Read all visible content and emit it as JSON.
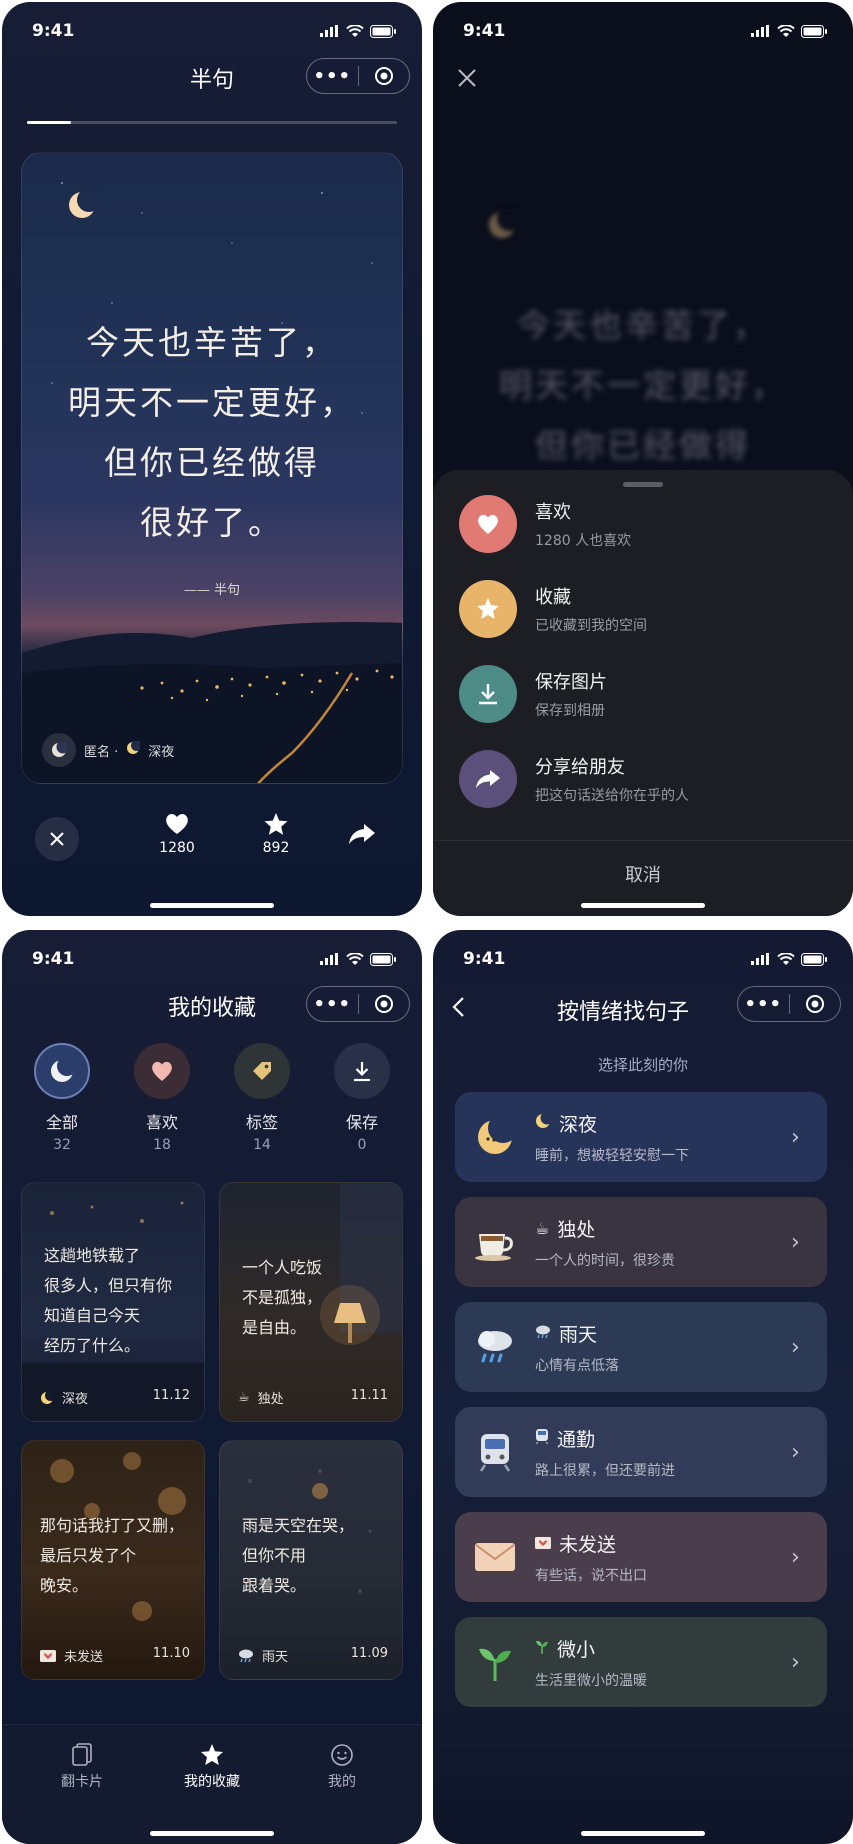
{
  "status_time": "9:41",
  "screen1": {
    "title": "半句",
    "progress": 0.12,
    "quote_lines": [
      "今天也辛苦了，",
      "明天不一定更好，",
      "但你已经做得",
      "很好了。"
    ],
    "author": "—— 半句",
    "footer_user": "匿名 ·",
    "footer_tag": "深夜",
    "likes": "1280",
    "favorites": "892"
  },
  "screen2": {
    "blur_lines": [
      "今天也辛苦了，",
      "明天不一定更好，",
      "但你已经做得"
    ],
    "menu": [
      {
        "title": "喜欢",
        "sub": "1280 人也喜欢",
        "icon": "heart-icon",
        "color": "#e07a73"
      },
      {
        "title": "收藏",
        "sub": "已收藏到我的空间",
        "icon": "star-icon",
        "color": "#e7b46a"
      },
      {
        "title": "保存图片",
        "sub": "保存到相册",
        "icon": "download-icon",
        "color": "#4d8b86"
      },
      {
        "title": "分享给朋友",
        "sub": "把这句话送给你在乎的人",
        "icon": "share-icon",
        "color": "#5b4f7c"
      }
    ],
    "cancel": "取消"
  },
  "screen3": {
    "title": "我的收藏",
    "filters": [
      {
        "label": "全部",
        "count": "32"
      },
      {
        "label": "喜欢",
        "count": "18"
      },
      {
        "label": "标签",
        "count": "14"
      },
      {
        "label": "保存",
        "count": "0"
      }
    ],
    "cards": [
      {
        "text": "这趟地铁载了很多人，但只有你知道自己今天经历了什么。",
        "tag": "深夜",
        "date": "11.12"
      },
      {
        "text": "一个人吃饭不是孤独，是自由。",
        "tag": "独处",
        "date": "11.11"
      },
      {
        "text": "那句话我打了又删，最后只发了个晚安。",
        "tag": "未发送",
        "date": "11.10"
      },
      {
        "text": "雨是天空在哭，但你不用跟着哭。",
        "tag": "雨天",
        "date": "11.09"
      }
    ],
    "card_lines": [
      [
        "这趟地铁载了",
        "很多人，但只有你",
        "知道自己今天",
        "经历了什么。"
      ],
      [
        "一个人吃饭",
        "不是孤独，",
        "是自由。"
      ],
      [
        "那句话我打了又删，",
        "最后只发了个",
        "晚安。"
      ],
      [
        "雨是天空在哭，",
        "但你不用",
        "跟着哭。"
      ]
    ],
    "tabs": [
      "翻卡片",
      "我的收藏",
      "我的"
    ]
  },
  "screen4": {
    "title": "按情绪找句子",
    "subtitle": "选择此刻的你",
    "moods": [
      {
        "name": "深夜",
        "desc": "睡前，想被轻轻安慰一下",
        "emoji": "🌜",
        "bg": "#27345a"
      },
      {
        "name": "独处",
        "desc": "一个人的时间，很珍贵",
        "emoji": "☕",
        "bg": "#3a3340"
      },
      {
        "name": "雨天",
        "desc": "心情有点低落",
        "emoji": "🌧",
        "bg": "#2c3a55"
      },
      {
        "name": "通勤",
        "desc": "路上很累，但还要前进",
        "emoji": "🚆",
        "bg": "#323b57"
      },
      {
        "name": "未发送",
        "desc": "有些话，说不出口",
        "emoji": "✉",
        "bg": "#4a3d4c"
      },
      {
        "name": "微小",
        "desc": "生活里微小的温暖",
        "emoji": "🌱",
        "bg": "#323c3c"
      }
    ]
  },
  "colors": {
    "accent": "#e7b46a",
    "heart": "#e07a73"
  }
}
